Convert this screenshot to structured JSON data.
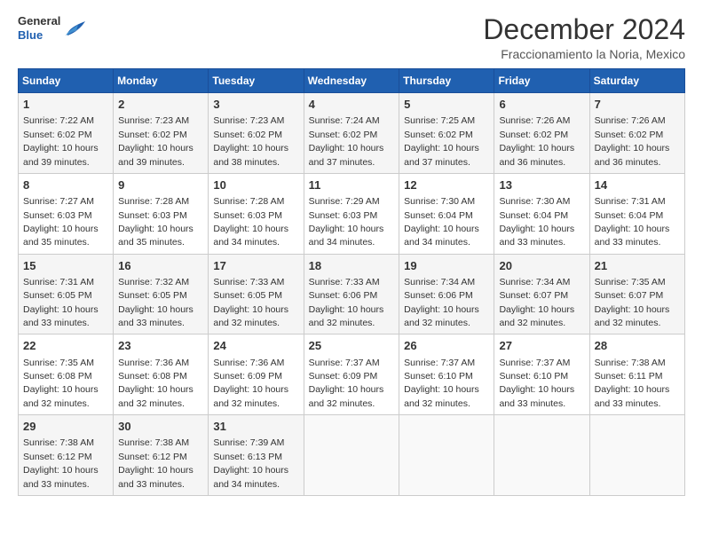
{
  "header": {
    "logo_general": "General",
    "logo_blue": "Blue",
    "title": "December 2024",
    "subtitle": "Fraccionamiento la Noria, Mexico"
  },
  "calendar": {
    "days_of_week": [
      "Sunday",
      "Monday",
      "Tuesday",
      "Wednesday",
      "Thursday",
      "Friday",
      "Saturday"
    ],
    "weeks": [
      [
        null,
        {
          "day": 2,
          "sunrise": "7:23 AM",
          "sunset": "6:02 PM",
          "daylight": "10 hours and 39 minutes."
        },
        {
          "day": 3,
          "sunrise": "7:23 AM",
          "sunset": "6:02 PM",
          "daylight": "10 hours and 38 minutes."
        },
        {
          "day": 4,
          "sunrise": "7:24 AM",
          "sunset": "6:02 PM",
          "daylight": "10 hours and 37 minutes."
        },
        {
          "day": 5,
          "sunrise": "7:25 AM",
          "sunset": "6:02 PM",
          "daylight": "10 hours and 37 minutes."
        },
        {
          "day": 6,
          "sunrise": "7:26 AM",
          "sunset": "6:02 PM",
          "daylight": "10 hours and 36 minutes."
        },
        {
          "day": 7,
          "sunrise": "7:26 AM",
          "sunset": "6:02 PM",
          "daylight": "10 hours and 36 minutes."
        }
      ],
      [
        {
          "day": 1,
          "sunrise": "7:22 AM",
          "sunset": "6:02 PM",
          "daylight": "10 hours and 39 minutes."
        },
        {
          "day": 9,
          "sunrise": "7:28 AM",
          "sunset": "6:03 PM",
          "daylight": "10 hours and 35 minutes."
        },
        {
          "day": 10,
          "sunrise": "7:28 AM",
          "sunset": "6:03 PM",
          "daylight": "10 hours and 34 minutes."
        },
        {
          "day": 11,
          "sunrise": "7:29 AM",
          "sunset": "6:03 PM",
          "daylight": "10 hours and 34 minutes."
        },
        {
          "day": 12,
          "sunrise": "7:30 AM",
          "sunset": "6:04 PM",
          "daylight": "10 hours and 34 minutes."
        },
        {
          "day": 13,
          "sunrise": "7:30 AM",
          "sunset": "6:04 PM",
          "daylight": "10 hours and 33 minutes."
        },
        {
          "day": 14,
          "sunrise": "7:31 AM",
          "sunset": "6:04 PM",
          "daylight": "10 hours and 33 minutes."
        }
      ],
      [
        {
          "day": 8,
          "sunrise": "7:27 AM",
          "sunset": "6:03 PM",
          "daylight": "10 hours and 35 minutes."
        },
        {
          "day": 16,
          "sunrise": "7:32 AM",
          "sunset": "6:05 PM",
          "daylight": "10 hours and 33 minutes."
        },
        {
          "day": 17,
          "sunrise": "7:33 AM",
          "sunset": "6:05 PM",
          "daylight": "10 hours and 32 minutes."
        },
        {
          "day": 18,
          "sunrise": "7:33 AM",
          "sunset": "6:06 PM",
          "daylight": "10 hours and 32 minutes."
        },
        {
          "day": 19,
          "sunrise": "7:34 AM",
          "sunset": "6:06 PM",
          "daylight": "10 hours and 32 minutes."
        },
        {
          "day": 20,
          "sunrise": "7:34 AM",
          "sunset": "6:07 PM",
          "daylight": "10 hours and 32 minutes."
        },
        {
          "day": 21,
          "sunrise": "7:35 AM",
          "sunset": "6:07 PM",
          "daylight": "10 hours and 32 minutes."
        }
      ],
      [
        {
          "day": 15,
          "sunrise": "7:31 AM",
          "sunset": "6:05 PM",
          "daylight": "10 hours and 33 minutes."
        },
        {
          "day": 23,
          "sunrise": "7:36 AM",
          "sunset": "6:08 PM",
          "daylight": "10 hours and 32 minutes."
        },
        {
          "day": 24,
          "sunrise": "7:36 AM",
          "sunset": "6:09 PM",
          "daylight": "10 hours and 32 minutes."
        },
        {
          "day": 25,
          "sunrise": "7:37 AM",
          "sunset": "6:09 PM",
          "daylight": "10 hours and 32 minutes."
        },
        {
          "day": 26,
          "sunrise": "7:37 AM",
          "sunset": "6:10 PM",
          "daylight": "10 hours and 32 minutes."
        },
        {
          "day": 27,
          "sunrise": "7:37 AM",
          "sunset": "6:10 PM",
          "daylight": "10 hours and 33 minutes."
        },
        {
          "day": 28,
          "sunrise": "7:38 AM",
          "sunset": "6:11 PM",
          "daylight": "10 hours and 33 minutes."
        }
      ],
      [
        {
          "day": 22,
          "sunrise": "7:35 AM",
          "sunset": "6:08 PM",
          "daylight": "10 hours and 32 minutes."
        },
        {
          "day": 30,
          "sunrise": "7:38 AM",
          "sunset": "6:12 PM",
          "daylight": "10 hours and 33 minutes."
        },
        {
          "day": 31,
          "sunrise": "7:39 AM",
          "sunset": "6:13 PM",
          "daylight": "10 hours and 34 minutes."
        },
        null,
        null,
        null,
        null
      ],
      [
        {
          "day": 29,
          "sunrise": "7:38 AM",
          "sunset": "6:12 PM",
          "daylight": "10 hours and 33 minutes."
        },
        null,
        null,
        null,
        null,
        null,
        null
      ]
    ]
  }
}
